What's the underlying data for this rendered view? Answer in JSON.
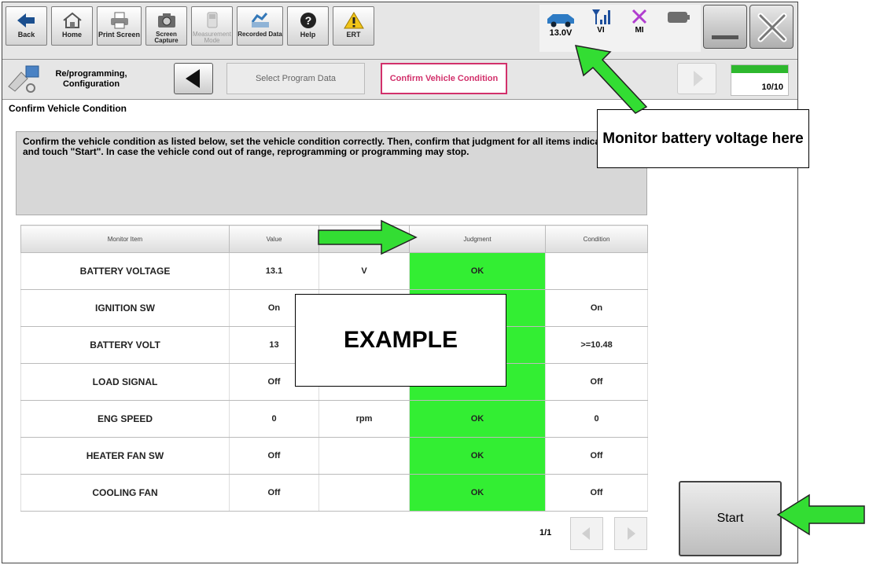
{
  "toolbar": {
    "buttons": [
      {
        "label": "Back",
        "icon": "back-arrow-icon"
      },
      {
        "label": "Home",
        "icon": "home-icon"
      },
      {
        "label": "Print Screen",
        "icon": "printer-icon"
      },
      {
        "label": "Screen Capture",
        "icon": "camera-icon"
      },
      {
        "label": "Measurement Mode",
        "icon": "measurement-icon"
      },
      {
        "label": "Recorded Data",
        "icon": "recorded-data-icon"
      },
      {
        "label": "Help",
        "icon": "help-icon"
      },
      {
        "label": "ERT",
        "icon": "warning-icon"
      }
    ],
    "status": {
      "voltage": "13.0V",
      "vi_label": "VI",
      "mi_label": "MI"
    }
  },
  "breadcrumb": {
    "title": "Re/programming, Configuration",
    "step_previous": "Select Program Data",
    "step_current": "Confirm Vehicle Condition",
    "progress_text": "10/10",
    "progress_fraction": 1.0
  },
  "main": {
    "section_title": "Confirm Vehicle Condition",
    "instructions": "Confirm the vehicle condition as listed below, set the vehicle condition correctly. Then, confirm that judgment for all items indicate OK, and touch \"Start\". In case the vehicle cond out of range, reprogramming or programming may stop.",
    "columns": [
      "Monitor Item",
      "Value",
      "",
      "Judgment",
      "Condition"
    ],
    "rows": [
      {
        "item": "BATTERY VOLTAGE",
        "value": "13.1",
        "unit": "V",
        "judgment": "OK",
        "condition": ""
      },
      {
        "item": "IGNITION SW",
        "value": "On",
        "unit": "",
        "judgment": "",
        "condition": "On"
      },
      {
        "item": "BATTERY VOLT",
        "value": "13",
        "unit": "",
        "judgment": "",
        "condition": ">=10.48"
      },
      {
        "item": "LOAD SIGNAL",
        "value": "Off",
        "unit": "",
        "judgment": "",
        "condition": "Off"
      },
      {
        "item": "ENG SPEED",
        "value": "0",
        "unit": "rpm",
        "judgment": "OK",
        "condition": "0"
      },
      {
        "item": "HEATER FAN SW",
        "value": "Off",
        "unit": "",
        "judgment": "OK",
        "condition": "Off"
      },
      {
        "item": "COOLING FAN",
        "value": "Off",
        "unit": "",
        "judgment": "OK",
        "condition": "Off"
      }
    ],
    "pager": "1/1",
    "start_label": "Start"
  },
  "overlays": {
    "callout_text": "Monitor battery voltage here",
    "example_text": "EXAMPLE"
  },
  "colors": {
    "ok_green": "#33ee33",
    "arrow_green": "#33dd33",
    "active_step_pink": "#d2306b",
    "progress_green": "#2eb82e"
  }
}
